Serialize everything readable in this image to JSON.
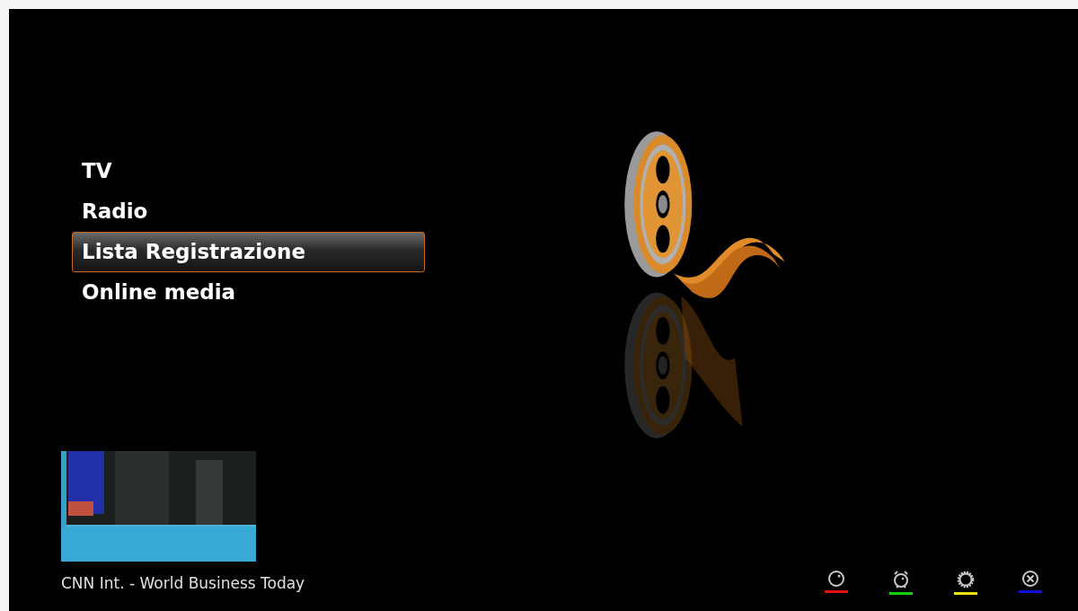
{
  "menu": {
    "items": [
      {
        "label": "TV",
        "selected": false
      },
      {
        "label": "Radio",
        "selected": false
      },
      {
        "label": "Lista Registrazione",
        "selected": true
      },
      {
        "label": "Online media",
        "selected": false
      }
    ]
  },
  "preview": {
    "caption": "CNN Int. - World Business Today"
  },
  "function_keys": [
    {
      "kind": "clock",
      "color": "#e01010"
    },
    {
      "kind": "alarm",
      "color": "#10d010"
    },
    {
      "kind": "gear",
      "color": "#e8e010"
    },
    {
      "kind": "close",
      "color": "#1010d8"
    }
  ]
}
